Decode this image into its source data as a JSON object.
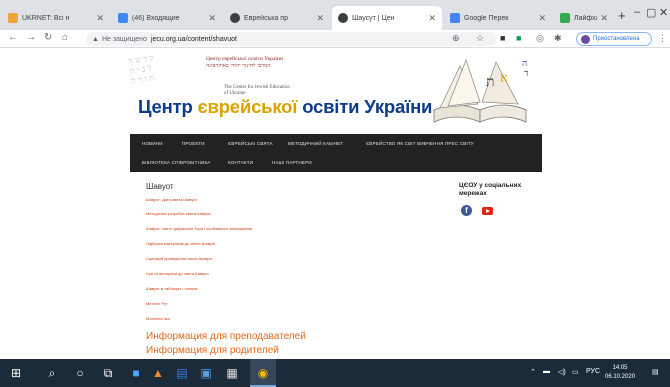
{
  "browser": {
    "tabs": [
      {
        "title": "UKRNET: Всі н",
        "favicon_color": "#f2a33a",
        "active": false
      },
      {
        "title": "(46) Входящие",
        "favicon_color": "#3f87f5",
        "active": false
      },
      {
        "title": "Еврейська пр",
        "favicon_color": "#3c4043",
        "active": false
      },
      {
        "title": "Шаусут | Цен",
        "favicon_color": "#3c4043",
        "active": true
      },
      {
        "title": "Google Перек",
        "favicon_color": "#4285f4",
        "active": false
      },
      {
        "title": "Лайфхаки вс",
        "favicon_color": "#34a853",
        "active": false
      }
    ],
    "new_tab": "+",
    "address": {
      "status": "Не защищено",
      "url": "jecu.org.ua/content/shavuot"
    },
    "profile_label": "Приостановлена"
  },
  "site": {
    "org_name_ua": "Центр єврейської освіти України",
    "org_name_he": "המרכז לחינוך יהודי באוקראינה",
    "org_name_en_1": "The Center for Jewish Education",
    "org_name_en_2": "of Ukraine",
    "title_part1": "Центр ",
    "title_highlight": "єврейської",
    "title_part2": " освіти України",
    "nav": [
      "Новини",
      "Проекти",
      "Єврейські свята",
      "Методичний кабінет",
      "Єврейство як світ вивчення прес світу",
      "Бібліотека співробітника",
      "Контакти",
      "Наші партнери"
    ],
    "content_title": "Шавуот",
    "links": [
      "Шавуот: Дата свята Шавуот",
      "Методична розробка свята Шавуот",
      "Шавуот: свято дарування Тори і особливості святкування",
      "Підборка матеріалів до свята Шавуот",
      "Сценарій проведення свята Шавуот",
      "Ігри та вікторини до свята Шавуот",
      "Шавуот в таблицях і схемах",
      "Мегілат Рут",
      "Молочна їжа"
    ],
    "big_links": [
      "Информация для преподавателей",
      "Информация для родителей"
    ],
    "social_title": "ЦЄОУ у соціальних мережах",
    "facebook_glyph": "f"
  },
  "taskbar": {
    "tray_lang": "РУС",
    "time": "14:05",
    "date": "06.10.2020"
  },
  "colors": {
    "title_blue": "#0d3c8a",
    "title_gold": "#d9a400",
    "nav_bg": "#222222",
    "link_orange": "#d04010"
  }
}
